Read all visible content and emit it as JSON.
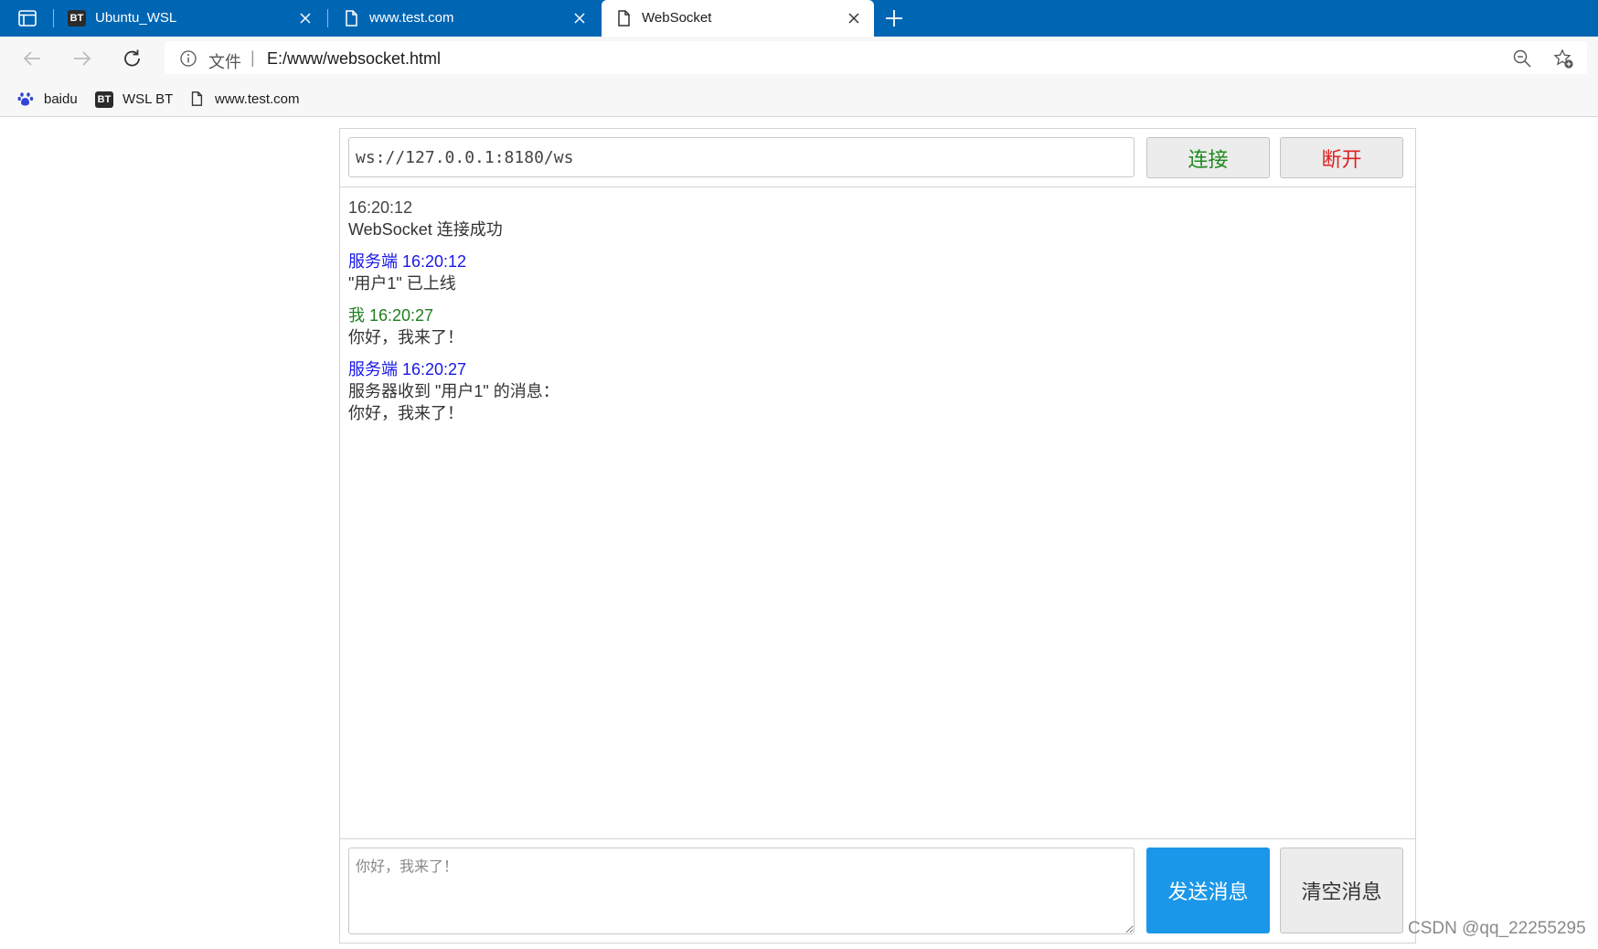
{
  "browser": {
    "tabs": [
      {
        "title": "Ubuntu_WSL",
        "icon": "bt-badge-icon",
        "badge": "BT"
      },
      {
        "title": "www.test.com",
        "icon": "page-icon"
      },
      {
        "title": "WebSocket",
        "icon": "page-icon",
        "active": true
      }
    ],
    "address": {
      "scheme_label": "文件",
      "separator": "|",
      "url": "E:/www/websocket.html"
    },
    "bookmarks": [
      {
        "label": "baidu",
        "icon": "baidu-paw-icon"
      },
      {
        "label": "WSL BT",
        "icon": "bt-badge-icon",
        "badge": "BT"
      },
      {
        "label": "www.test.com",
        "icon": "page-icon"
      }
    ],
    "accent_color": "#0066b4"
  },
  "app": {
    "server_url_value": "ws://127.0.0.1:8180/ws",
    "connect_label": "连接",
    "disconnect_label": "断开",
    "messages": [
      {
        "head": "16:20:12",
        "body": "WebSocket 连接成功"
      },
      {
        "head": "服务端 16:20:12",
        "body": "\"用户1\" 已上线"
      },
      {
        "head": "我 16:20:27",
        "body": "你好，我来了！"
      },
      {
        "head": "服务端 16:20:27",
        "body": "服务器收到 \"用户1\" 的消息：\n你好，我来了！"
      }
    ],
    "message_input_placeholder": "你好，我来了！",
    "send_label": "发送消息",
    "clear_label": "清空消息",
    "colors": {
      "connect": "#1f8a1f",
      "disconnect": "#e02020",
      "server": "#1818e6",
      "self": "#1f7f1f",
      "system_ok": "#e41f1f",
      "send_button": "#1a97e8"
    }
  },
  "watermark": "CSDN @qq_22255295"
}
